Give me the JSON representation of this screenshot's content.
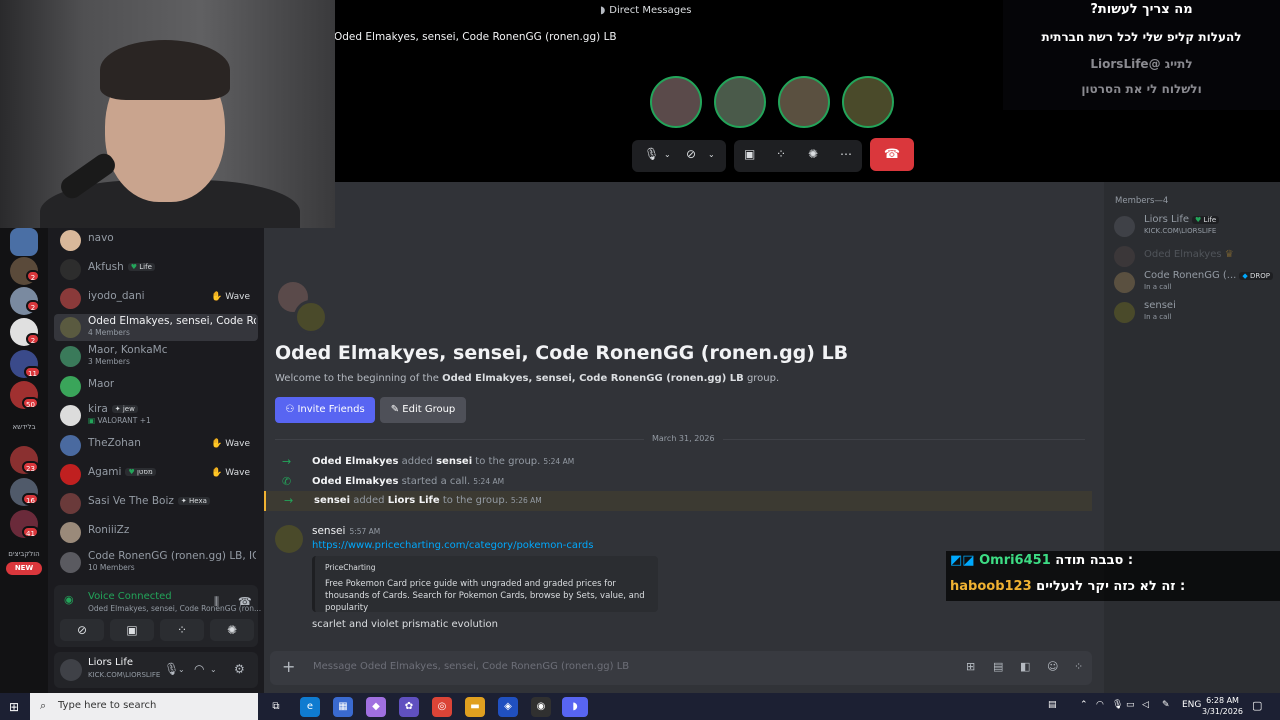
{
  "header": {
    "title": "Direct Messages",
    "call_title": "Oded Elmakyes, sensei, Code RonenGG (ronen.gg) LB"
  },
  "rail": {
    "badges": [
      "2",
      "2",
      "2",
      "11",
      "50",
      "23",
      "16",
      "41"
    ],
    "label_1": "בלידשא",
    "label_2": "הולקביצים",
    "new_label": "NEW"
  },
  "dms": [
    {
      "name": "navo",
      "sub": "",
      "tag": "",
      "wave": ""
    },
    {
      "name": "Akfush",
      "sub": "",
      "tag": "Life",
      "wave": ""
    },
    {
      "name": "iyodo_dani",
      "sub": "",
      "tag": "",
      "wave": "Wave"
    },
    {
      "name": "Oded Elmakyes, sensei, Code Rone...",
      "sub": "4 Members",
      "tag": "",
      "wave": ""
    },
    {
      "name": "Maor, KonkaMc",
      "sub": "3 Members",
      "tag": "",
      "wave": ""
    },
    {
      "name": "Maor",
      "sub": "",
      "tag": "",
      "wave": ""
    },
    {
      "name": "kira",
      "sub": "VALORANT +1",
      "tag": "jew",
      "wave": ""
    },
    {
      "name": "TheZohan",
      "sub": "",
      "tag": "",
      "wave": "Wave"
    },
    {
      "name": "Agami",
      "sub": "",
      "tag": "מסטן",
      "wave": "Wave"
    },
    {
      "name": "Sasi Ve The Boiz",
      "sub": "",
      "tag": "Hexa",
      "wave": ""
    },
    {
      "name": "RoniiiZz",
      "sub": "",
      "tag": "",
      "wave": ""
    },
    {
      "name": "Code RonenGG (ronen.gg) LB, IGZ, ...",
      "sub": "10 Members",
      "tag": "",
      "wave": ""
    }
  ],
  "voice": {
    "status": "Voice Connected",
    "channel": "Oded Elmakyes, sensei, Code RonenGG (ron..."
  },
  "user": {
    "name": "Liors Life",
    "status": "KICK.COM\\LIORSLIFE"
  },
  "group": {
    "title": "Oded Elmakyes, sensei, Code RonenGG (ronen.gg) LB",
    "welcome_prefix": "Welcome to the beginning of the ",
    "welcome_name": "Oded Elmakyes, sensei, Code RonenGG (ronen.gg) LB",
    "welcome_suffix": " group.",
    "invite_label": "Invite Friends",
    "edit_label": "Edit Group"
  },
  "date_divider": "March 31, 2026",
  "system_messages": [
    {
      "actor": "Oded Elmakyes",
      "verb": " added ",
      "target": "sensei",
      "rest": " to the group.",
      "time": "5:24 AM"
    },
    {
      "actor": "Oded Elmakyes",
      "verb": " started a call.",
      "target": "",
      "rest": "",
      "time": "5:24 AM"
    },
    {
      "actor": "sensei",
      "verb": " added ",
      "target": "Liors Life",
      "rest": " to the group.",
      "time": "5:26 AM"
    }
  ],
  "message": {
    "author": "sensei",
    "time": "5:57 AM",
    "link": "https://www.pricecharting.com/category/pokemon-cards",
    "embed_provider": "PriceCharting",
    "embed_desc": "Free Pokemon Card price guide with ungraded and graded prices for thousands of Cards. Search for Pokemon Cards, browse by Sets, value, and popularity",
    "followup": "scarlet and violet prismatic evolution"
  },
  "composer": {
    "placeholder": "Message Oded Elmakyes, sensei, Code RonenGG (ronen.gg) LB"
  },
  "members": {
    "header": "Members—4",
    "list": [
      {
        "name": "Liors Life",
        "tag": "Life",
        "sub": "KICK.COM\\LIORSLIFE"
      },
      {
        "name": "Oded Elmakyes",
        "tag": "",
        "sub": ""
      },
      {
        "name": "Code RonenGG (...",
        "tag": "DROP",
        "sub": "In a call"
      },
      {
        "name": "sensei",
        "tag": "",
        "sub": "In a call"
      }
    ]
  },
  "overlay": {
    "line1": "מה צריך לעשות?",
    "line2": "להעלות קליפ שלי לכל רשת חברתית",
    "line3": "לתייג @LiorsLife",
    "line4": "ולשלוח לי את הסרטון"
  },
  "stream_chat": [
    {
      "user": "Omri6451",
      "text": "סבבה תודה :",
      "color": "#3ddc84"
    },
    {
      "user": "haboob123",
      "text": "זה לא כזה יקר לנעליים :",
      "color": "#f0b232"
    }
  ],
  "taskbar": {
    "search_placeholder": "Type here to search",
    "lang": "ENG",
    "time": "6:28 AM",
    "date": "3/31/2026"
  },
  "colors": {
    "accent": "#5865f2",
    "danger": "#da373c",
    "online": "#23a55a",
    "link": "#00a8fc"
  }
}
